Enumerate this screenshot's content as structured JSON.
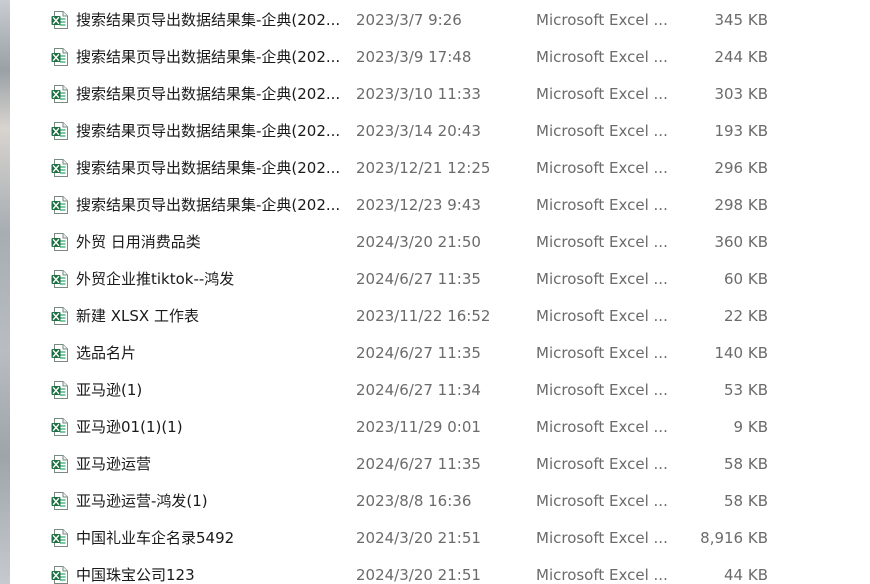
{
  "files": [
    {
      "name": "搜索结果页导出数据结果集-企典(202...",
      "date": "2023/3/7 9:26",
      "type": "Microsoft Excel ...",
      "size": "345 KB",
      "icon": "excel-file-icon"
    },
    {
      "name": "搜索结果页导出数据结果集-企典(202...",
      "date": "2023/3/9 17:48",
      "type": "Microsoft Excel ...",
      "size": "244 KB",
      "icon": "excel-file-icon"
    },
    {
      "name": "搜索结果页导出数据结果集-企典(202...",
      "date": "2023/3/10 11:33",
      "type": "Microsoft Excel ...",
      "size": "303 KB",
      "icon": "excel-file-icon"
    },
    {
      "name": "搜索结果页导出数据结果集-企典(202...",
      "date": "2023/3/14 20:43",
      "type": "Microsoft Excel ...",
      "size": "193 KB",
      "icon": "excel-file-icon"
    },
    {
      "name": "搜索结果页导出数据结果集-企典(202...",
      "date": "2023/12/21 12:25",
      "type": "Microsoft Excel ...",
      "size": "296 KB",
      "icon": "excel-file-icon"
    },
    {
      "name": "搜索结果页导出数据结果集-企典(202...",
      "date": "2023/12/23 9:43",
      "type": "Microsoft Excel ...",
      "size": "298 KB",
      "icon": "excel-file-icon"
    },
    {
      "name": "外贸 日用消费品类",
      "date": "2024/3/20 21:50",
      "type": "Microsoft Excel ...",
      "size": "360 KB",
      "icon": "excel-file-icon"
    },
    {
      "name": "外贸企业推tiktok--鸿发",
      "date": "2024/6/27 11:35",
      "type": "Microsoft Excel ...",
      "size": "60 KB",
      "icon": "excel-file-icon"
    },
    {
      "name": "新建 XLSX 工作表",
      "date": "2023/11/22 16:52",
      "type": "Microsoft Excel ...",
      "size": "22 KB",
      "icon": "excel-file-icon"
    },
    {
      "name": "选品名片",
      "date": "2024/6/27 11:35",
      "type": "Microsoft Excel ...",
      "size": "140 KB",
      "icon": "excel-file-icon"
    },
    {
      "name": "亚马逊(1)",
      "date": "2024/6/27 11:34",
      "type": "Microsoft Excel ...",
      "size": "53 KB",
      "icon": "excel-file-icon"
    },
    {
      "name": "亚马逊01(1)(1)",
      "date": "2023/11/29 0:01",
      "type": "Microsoft Excel ...",
      "size": "9 KB",
      "icon": "excel-file-icon"
    },
    {
      "name": "亚马逊运营",
      "date": "2024/6/27 11:35",
      "type": "Microsoft Excel ...",
      "size": "58 KB",
      "icon": "excel-file-icon"
    },
    {
      "name": "亚马逊运营-鸿发(1)",
      "date": "2023/8/8 16:36",
      "type": "Microsoft Excel ...",
      "size": "58 KB",
      "icon": "excel-file-icon"
    },
    {
      "name": "中国礼业车企名录5492",
      "date": "2024/3/20 21:51",
      "type": "Microsoft Excel ...",
      "size": "8,916 KB",
      "icon": "excel-file-icon"
    },
    {
      "name": "中国珠宝公司123",
      "date": "2024/3/20 21:51",
      "type": "Microsoft Excel ...",
      "size": "44 KB",
      "icon": "excel-file-icon"
    }
  ],
  "colors": {
    "excel_green": "#1d6f42",
    "excel_green_light": "#21a366",
    "name_text": "#1a1a1a",
    "meta_text": "#6b6b6b"
  }
}
